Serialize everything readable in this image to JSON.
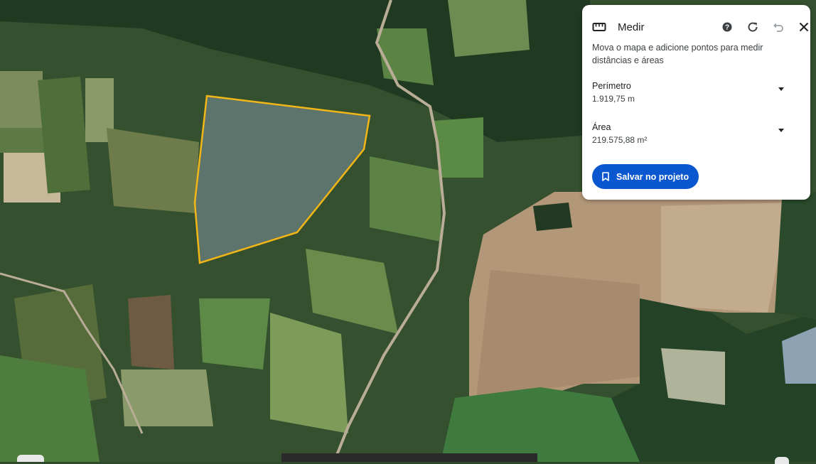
{
  "panel": {
    "title": "Medir",
    "description": "Mova o mapa e adicione pontos para medir distâncias e áreas",
    "icons": [
      "ruler-icon",
      "help-icon",
      "refresh-icon",
      "undo-icon",
      "close-icon"
    ],
    "perimeter": {
      "label": "Perímetro",
      "value": "1.919,75 m"
    },
    "area": {
      "label": "Área",
      "value": "219.575,88 m²"
    },
    "save_button": "Salvar no projeto"
  },
  "colors": {
    "accent": "#0b57d0",
    "polygon_stroke": "#f2b616",
    "polygon_fill": "#8fa0b8"
  }
}
